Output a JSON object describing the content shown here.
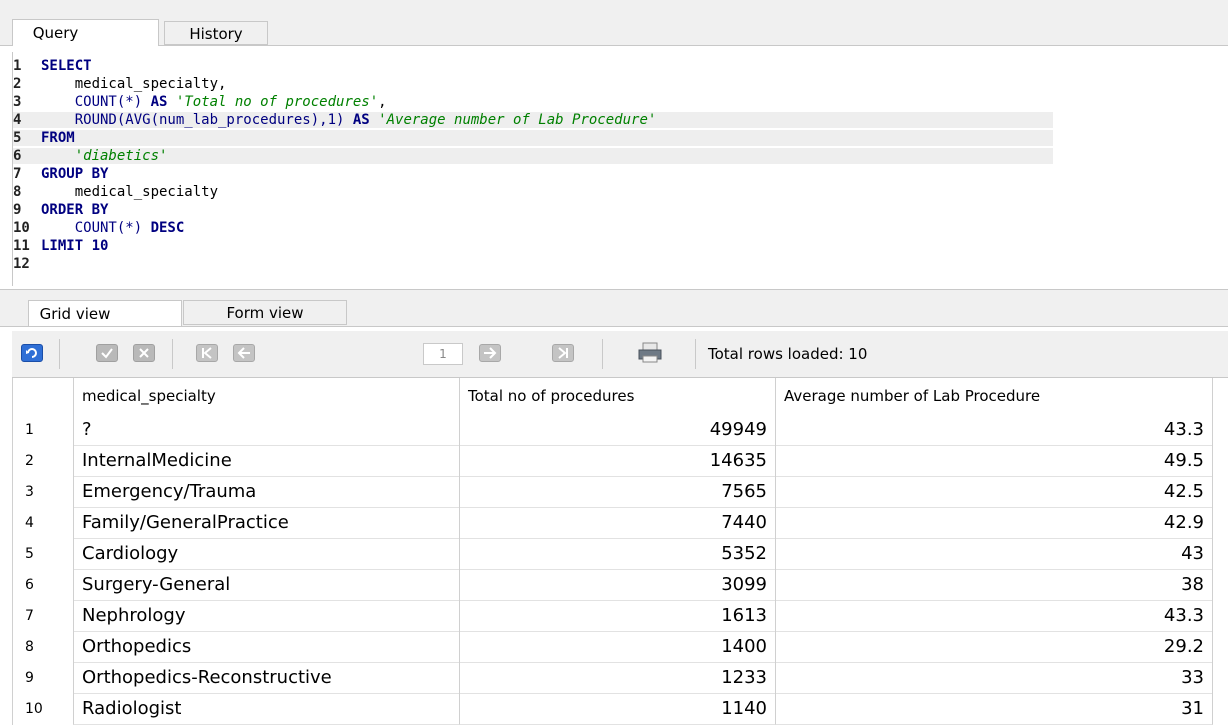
{
  "tabs": {
    "query": "Query",
    "history": "History"
  },
  "editor": {
    "lines": [
      {
        "n": "1",
        "segments": [
          {
            "t": "SELECT",
            "c": "kw"
          }
        ]
      },
      {
        "n": "2",
        "segments": [
          {
            "t": "    medical_specialty,",
            "c": ""
          }
        ]
      },
      {
        "n": "3",
        "segments": [
          {
            "t": "    COUNT(*) ",
            "c": "fn"
          },
          {
            "t": "AS",
            "c": "kw"
          },
          {
            "t": " 'Total no of procedures'",
            "c": "str"
          },
          {
            "t": ",",
            "c": ""
          }
        ]
      },
      {
        "n": "4",
        "segments": [
          {
            "t": "    ROUND(AVG(num_lab_procedures),1) ",
            "c": "fn"
          },
          {
            "t": "AS",
            "c": "kw"
          },
          {
            "t": " 'Average number of Lab Procedure'",
            "c": "str"
          }
        ]
      },
      {
        "n": "5",
        "segments": [
          {
            "t": "FROM",
            "c": "kw"
          }
        ]
      },
      {
        "n": "6",
        "segments": [
          {
            "t": "    'diabetics'",
            "c": "str"
          }
        ]
      },
      {
        "n": "7",
        "segments": [
          {
            "t": "GROUP BY",
            "c": "kw"
          }
        ]
      },
      {
        "n": "8",
        "segments": [
          {
            "t": "    medical_specialty",
            "c": ""
          }
        ]
      },
      {
        "n": "9",
        "segments": [
          {
            "t": "ORDER BY",
            "c": "kw"
          }
        ]
      },
      {
        "n": "10",
        "segments": [
          {
            "t": "    COUNT(*) ",
            "c": "fn"
          },
          {
            "t": "DESC",
            "c": "kw"
          }
        ]
      },
      {
        "n": "11",
        "segments": [
          {
            "t": "LIMIT 10",
            "c": "kw"
          }
        ]
      },
      {
        "n": "12",
        "segments": []
      }
    ]
  },
  "result_tabs": {
    "grid": "Grid view",
    "form": "Form view"
  },
  "toolbar": {
    "page": "1",
    "status": "Total rows loaded: 10",
    "icons": [
      "refresh-icon",
      "commit-icon",
      "rollback-icon",
      "first-page-icon",
      "prev-page-icon",
      "next-page-icon",
      "last-page-icon",
      "print-icon"
    ]
  },
  "grid": {
    "columns": [
      "medical_specialty",
      "Total no of procedures",
      "Average number of Lab Procedure"
    ],
    "rows": [
      [
        "1",
        "?",
        "49949",
        "43.3"
      ],
      [
        "2",
        "InternalMedicine",
        "14635",
        "49.5"
      ],
      [
        "3",
        "Emergency/Trauma",
        "7565",
        "42.5"
      ],
      [
        "4",
        "Family/GeneralPractice",
        "7440",
        "42.9"
      ],
      [
        "5",
        "Cardiology",
        "5352",
        "43"
      ],
      [
        "6",
        "Surgery-General",
        "3099",
        "38"
      ],
      [
        "7",
        "Nephrology",
        "1613",
        "43.3"
      ],
      [
        "8",
        "Orthopedics",
        "1400",
        "29.2"
      ],
      [
        "9",
        "Orthopedics-Reconstructive",
        "1233",
        "33"
      ],
      [
        "10",
        "Radiologist",
        "1140",
        "31"
      ]
    ]
  },
  "colors": {
    "keyword": "#000080",
    "string": "#008000",
    "accent": "#1e6fd9"
  }
}
